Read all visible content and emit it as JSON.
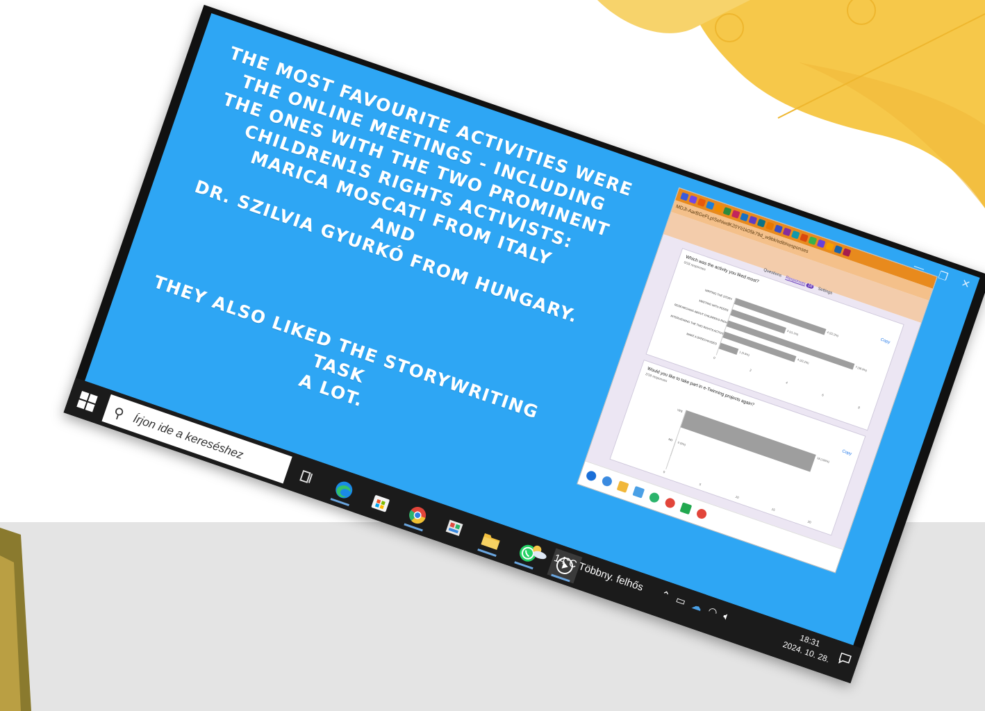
{
  "slide": {
    "main_lines": [
      "THE MOST FAVOURITE ACTIVITIES WERE",
      "THE ONLINE MEETINGS - INCLUDING",
      "THE ONES WITH THE TWO PROMINENT",
      "CHILDREN1S RIGHTS ACTIVISTS:",
      "MARICA MOSCATI FROM ITALY",
      "AND",
      "DR. SZILVIA GYURKÓ FROM  HUNGARY."
    ],
    "second_lines": [
      "THEY ALSO LIKED THE STORYWRITING TASK",
      "A LOT."
    ],
    "window_controls": {
      "minimize": "—",
      "maximize": "❐",
      "close": "✕"
    }
  },
  "embedded_screenshot": {
    "url_text": "MDJI-AarBGeFLpISehiwdK20YIi1k05k79d_w9bk/edit#responses",
    "tabs": [
      "Questions",
      "Responses",
      "Settings"
    ],
    "responses_badge": "18",
    "copy_label": "Copy",
    "q1": {
      "title": "Which was the activity you liked most?",
      "subtitle": "0/18 responses",
      "chart_data": {
        "type": "bar",
        "categories": [
          "WRITING THE STORY",
          "MEETING WITH PEERS",
          "RESEARCHING ABOUT CHILDREN'S RIGHTS",
          "INTERVIEWING THE TWO RIGHTS ACTIVISTS",
          "MAKE A SPEECH/VIDEO"
        ],
        "values": [
          5,
          3,
          7,
          4,
          1
        ],
        "value_labels": [
          "4 (22.2%)",
          "3 (11.1%)",
          "7 (38.9%)",
          "4 (22.2%)",
          "1 (5.6%)"
        ],
        "ticks": [
          "0",
          "2",
          "4",
          "6",
          "8"
        ]
      }
    },
    "q2": {
      "title": "Would you like to take part in e-Twinning projects again?",
      "subtitle": "2/18 responses",
      "chart_data": {
        "type": "bar",
        "categories": [
          "YES",
          "NO"
        ],
        "values": [
          18,
          0
        ],
        "value_labels": [
          "18 (100%)",
          "0 (0%)"
        ],
        "ticks": [
          "0",
          "5",
          "10",
          "15",
          "20"
        ]
      }
    }
  },
  "taskbar": {
    "search_placeholder": "Írjon ide a kereséshez",
    "weather": "14°C  Többny. felhős",
    "time": "18:31",
    "date": "2024. 10. 28.",
    "apps": [
      "task-view",
      "edge",
      "store",
      "chrome",
      "photos",
      "file-explorer",
      "whatsapp",
      "media-player"
    ]
  },
  "colors": {
    "slide_bg": "#2ea6f4",
    "taskbar_bg": "#1b1b1b",
    "accent_yellow": "#f6c84a"
  }
}
